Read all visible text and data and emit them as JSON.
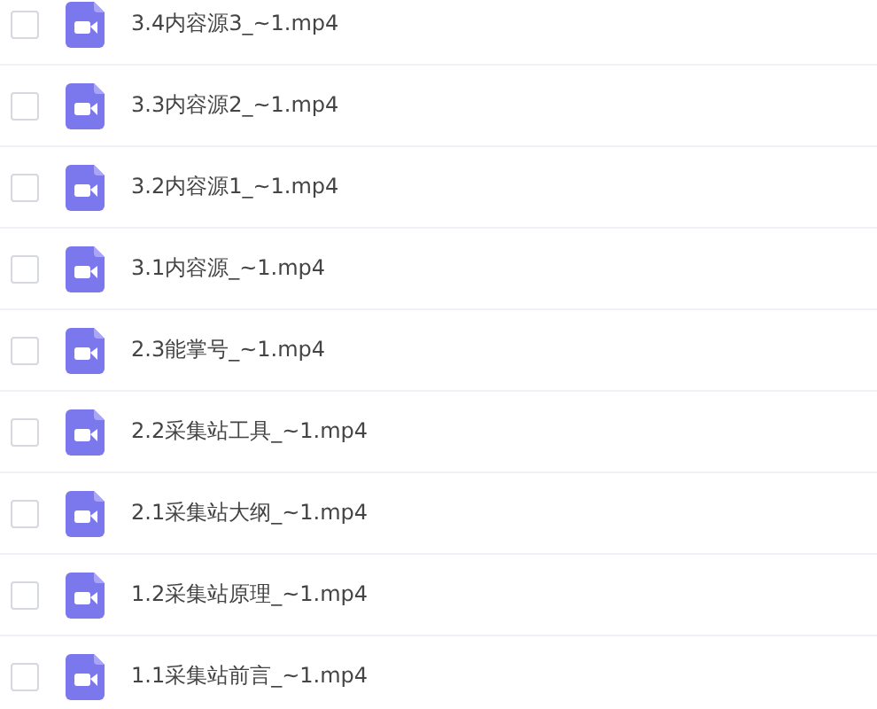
{
  "files": [
    {
      "name": "3.4内容源3_~1.mp4",
      "checked": false
    },
    {
      "name": "3.3内容源2_~1.mp4",
      "checked": false
    },
    {
      "name": "3.2内容源1_~1.mp4",
      "checked": false
    },
    {
      "name": "3.1内容源_~1.mp4",
      "checked": false
    },
    {
      "name": "2.3能掌号_~1.mp4",
      "checked": false
    },
    {
      "name": "2.2采集站工具_~1.mp4",
      "checked": false
    },
    {
      "name": "2.1采集站大纲_~1.mp4",
      "checked": false
    },
    {
      "name": "1.2采集站原理_~1.mp4",
      "checked": false
    },
    {
      "name": "1.1采集站前言_~1.mp4",
      "checked": false
    }
  ]
}
